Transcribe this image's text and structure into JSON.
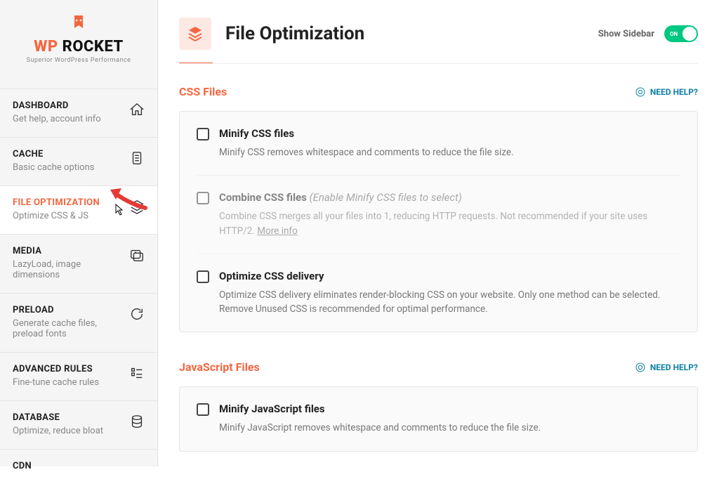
{
  "logo": {
    "wp": "WP",
    "rocket": " ROCKET",
    "sub": "Superior WordPress Performance"
  },
  "nav": {
    "dashboard": {
      "title": "DASHBOARD",
      "sub": "Get help, account info"
    },
    "cache": {
      "title": "CACHE",
      "sub": "Basic cache options"
    },
    "file_opt": {
      "title": "FILE OPTIMIZATION",
      "sub": "Optimize CSS & JS"
    },
    "media": {
      "title": "MEDIA",
      "sub": "LazyLoad, image dimensions"
    },
    "preload": {
      "title": "PRELOAD",
      "sub": "Generate cache files, preload fonts"
    },
    "advanced": {
      "title": "ADVANCED RULES",
      "sub": "Fine-tune cache rules"
    },
    "database": {
      "title": "DATABASE",
      "sub": "Optimize, reduce bloat"
    },
    "cdn": {
      "title": "CDN",
      "sub": ""
    }
  },
  "header": {
    "title": "File Optimization",
    "show_sidebar": "Show Sidebar",
    "toggle_state": "ON"
  },
  "sections": {
    "css": {
      "title": "CSS Files",
      "need_help": "NEED HELP?"
    },
    "js": {
      "title": "JavaScript Files",
      "need_help": "NEED HELP?"
    }
  },
  "options": {
    "minify_css": {
      "title": "Minify CSS files",
      "desc": "Minify CSS removes whitespace and comments to reduce the file size."
    },
    "combine_css": {
      "title": "Combine CSS files ",
      "note": "(Enable Minify CSS files to select)",
      "desc": "Combine CSS merges all your files into 1, reducing HTTP requests. Not recommended if your site uses HTTP/2. ",
      "more": "More info"
    },
    "optimize_css": {
      "title": "Optimize CSS delivery",
      "desc": "Optimize CSS delivery eliminates render-blocking CSS on your website. Only one method can be selected. Remove Unused CSS is recommended for optimal performance."
    },
    "minify_js": {
      "title": "Minify JavaScript files",
      "desc": "Minify JavaScript removes whitespace and comments to reduce the file size."
    }
  }
}
